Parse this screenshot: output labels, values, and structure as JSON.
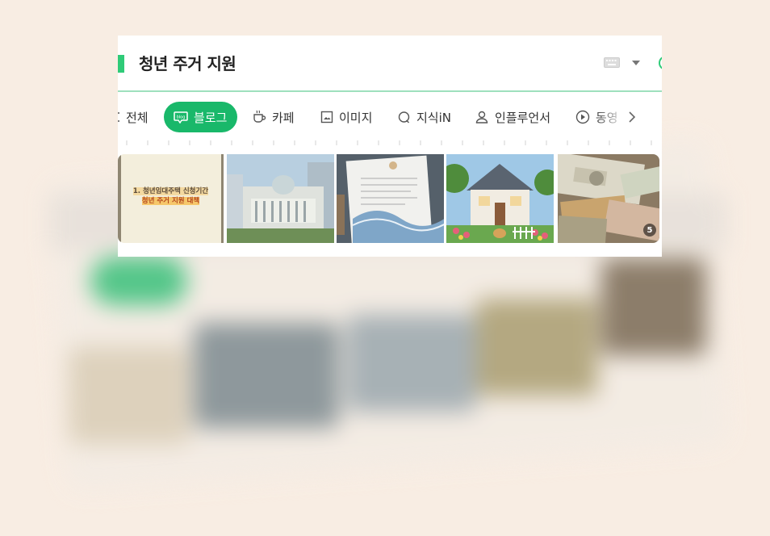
{
  "search": {
    "query": "청년 주거 지원"
  },
  "tabs": [
    {
      "label": "전체",
      "icon": "grid-icon",
      "active": false
    },
    {
      "label": "블로그",
      "icon": "blog-icon",
      "active": true
    },
    {
      "label": "카페",
      "icon": "cafe-icon",
      "active": false
    },
    {
      "label": "이미지",
      "icon": "image-icon",
      "active": false
    },
    {
      "label": "지식iN",
      "icon": "knowledge-icon",
      "active": false
    },
    {
      "label": "인플루언서",
      "icon": "person-icon",
      "active": false
    },
    {
      "label": "동영",
      "icon": "play-icon",
      "active": false
    }
  ],
  "thumbnails": {
    "first_line1": "1. 청년임대주택 신청기간",
    "first_line2": "청년 주거 지원 대책",
    "count": "5"
  },
  "colors": {
    "accent": "#19b86a",
    "background": "#f8ede3"
  }
}
